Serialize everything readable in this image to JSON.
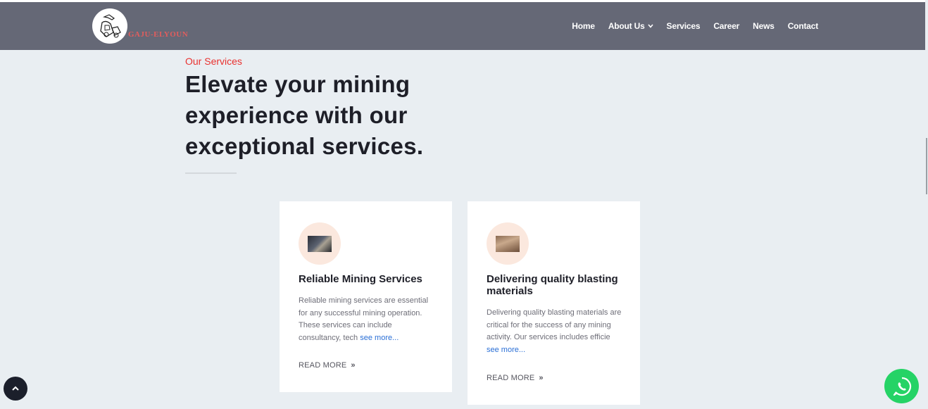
{
  "brand": {
    "name": "GAJU-ELYOUN",
    "icon": "mining-logo-icon"
  },
  "nav": {
    "items": [
      {
        "label": "Home"
      },
      {
        "label": "About Us",
        "has_dropdown": true
      },
      {
        "label": "Services"
      },
      {
        "label": "Career"
      },
      {
        "label": "News"
      },
      {
        "label": "Contact"
      }
    ]
  },
  "section": {
    "kicker": "Our Services",
    "headline": "Elevate your mining experience with our exceptional services."
  },
  "cards": [
    {
      "title": "Reliable Mining Services",
      "text": "Reliable mining services are essential for any successful mining operation. These services can include consultancy, tech",
      "see_more": "see more...",
      "read_more": "READ MORE",
      "arrow": "»",
      "image": "mining-machinery-image"
    },
    {
      "title": "Delivering quality blasting materials",
      "text": "Delivering quality blasting materials are critical for the success of any mining activity. Our services includes efficie",
      "see_more": "see more...",
      "read_more": "READ MORE",
      "arrow": "»",
      "image": "blasting-materials-image"
    }
  ],
  "colors": {
    "navbar": "#656876",
    "accent": "#e9312f",
    "background": "#e9eef2",
    "link": "#2a6fd6",
    "whatsapp": "#25d366"
  }
}
